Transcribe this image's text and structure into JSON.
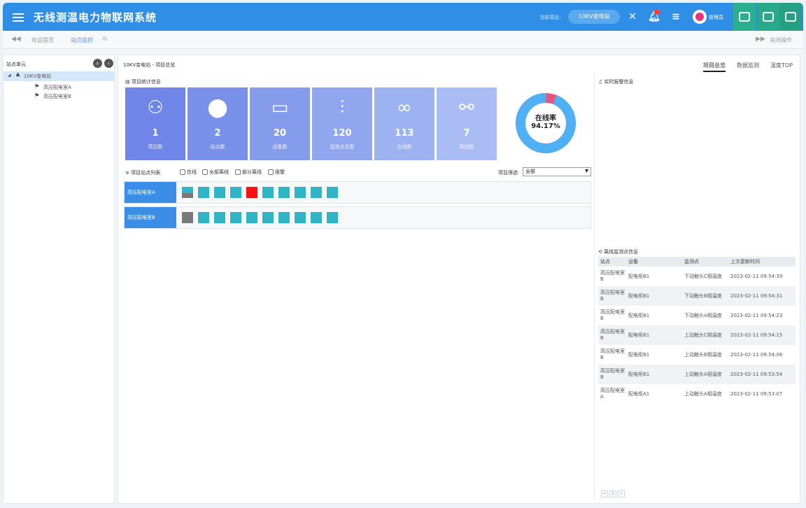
{
  "header": {
    "title": "无线测温电力物联网系统",
    "current_project_label": "当前项目:",
    "current_project": "10KV变电站",
    "admin_name": "管理员",
    "accent": "#2f8ee6"
  },
  "tabs": {
    "welcome": "欢迎首页",
    "monitor": "站点监控",
    "close_ops": "关闭操作"
  },
  "tree": {
    "header": "站点单元",
    "root": "10KV变电站",
    "children": [
      "高压配电室A",
      "高压配电室B"
    ]
  },
  "main": {
    "breadcrumb": "10KV变电站 - 项目总览",
    "right_tabs": [
      "项目总览",
      "数据监测",
      "温度TOP"
    ],
    "stats_title": "项目统计信息",
    "tiles": [
      {
        "icon": "sitemap-icon",
        "value": "1",
        "label": "项目数",
        "color": "#6f86e8"
      },
      {
        "icon": "location-pin-icon",
        "value": "2",
        "label": "站点数",
        "color": "#7a91ea"
      },
      {
        "icon": "device-icon",
        "value": "20",
        "label": "设备数",
        "color": "#859ced"
      },
      {
        "icon": "sliders-icon",
        "value": "120",
        "label": "监测点总数",
        "color": "#90a6ef"
      },
      {
        "icon": "link-icon",
        "value": "113",
        "label": "在线数",
        "color": "#9db2f1"
      },
      {
        "icon": "broken-link-icon",
        "value": "7",
        "label": "离线数",
        "color": "#a9bcf4"
      }
    ],
    "online_rate_label": "在线率",
    "online_rate": "94.17%",
    "online_rate_value": 0.9417,
    "list_title": "项目站点列表",
    "filters": [
      "在线",
      "全部离线",
      "部分离线",
      "报警"
    ],
    "project_filter_label": "项目筛选",
    "project_filter_value": "全部",
    "stations": [
      {
        "name": "高压配电室A",
        "devices": [
          "partial-offline",
          "online",
          "online",
          "online",
          "alarm",
          "online",
          "online",
          "online",
          "online",
          "online"
        ]
      },
      {
        "name": "高压配电室B",
        "devices": [
          "offline",
          "online",
          "online",
          "online",
          "online",
          "online",
          "online",
          "online",
          "online",
          "online"
        ]
      }
    ],
    "status_colors": {
      "online": "#2fb5c6",
      "alarm": "#ff1010",
      "offline": "#7a7a7a"
    }
  },
  "alarm": {
    "title": "实时报警信息"
  },
  "offline": {
    "title": "离线监测点信息",
    "columns": [
      "站点",
      "设备",
      "监测点",
      "上次更新时间"
    ],
    "rows": [
      [
        "高压配电室B",
        "配电柜B1",
        "下动触头C相温度",
        "2023-02-11 09:54:39"
      ],
      [
        "高压配电室B",
        "配电柜B1",
        "下动触头B相温度",
        "2023-02-11 09:54:31"
      ],
      [
        "高压配电室B",
        "配电柜B1",
        "下动触头A相温度",
        "2023-02-11 09:54:23"
      ],
      [
        "高压配电室B",
        "配电柜B1",
        "上动触头C相温度",
        "2023-02-11 09:54:15"
      ],
      [
        "高压配电室B",
        "配电柜B1",
        "上动触头B相温度",
        "2023-02-11 09:54:06"
      ],
      [
        "高压配电室B",
        "配电柜B1",
        "上动触头A相温度",
        "2023-02-11 09:53:54"
      ],
      [
        "高压配电室A",
        "配电柜A1",
        "上动触头A相温度",
        "2023-02-11 09:53:07"
      ]
    ],
    "pager": [
      "«",
      "1",
      "»"
    ]
  }
}
